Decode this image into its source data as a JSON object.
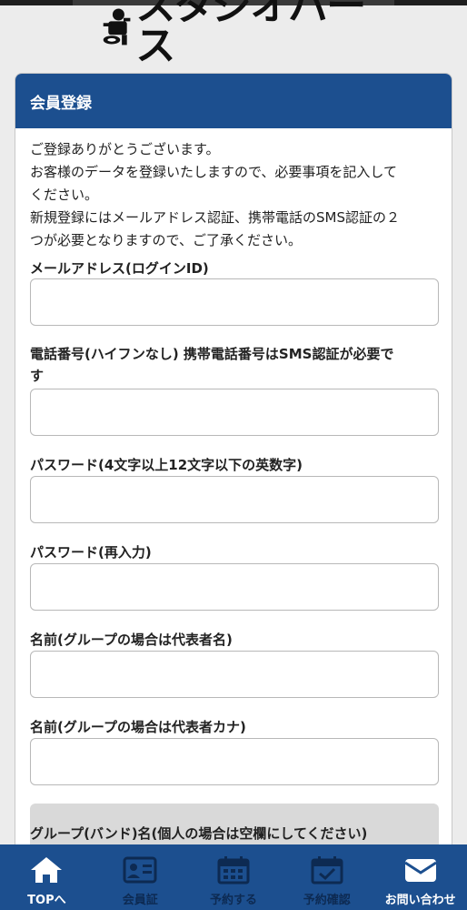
{
  "brand": {
    "logo_text": "スタジオパース"
  },
  "form": {
    "title": "会員登録",
    "intro_lines": [
      "ご登録ありがとうございます。",
      "お客様のデータを登録いたしますので、必要事項を記入して",
      "ください。",
      "新規登録にはメールアドレス認証、携帯電話のSMS認証の２",
      "つが必要となりますので、ご了承ください。"
    ],
    "fields": [
      {
        "label": "メールアドレス(ログインID)",
        "value": ""
      },
      {
        "label_line1": "電話番号(ハイフンなし) 携帯電話番号はSMS認証が必要で",
        "label_line2": "す",
        "value": ""
      },
      {
        "label": "パスワード(4文字以上12文字以下の英数字)",
        "value": ""
      },
      {
        "label": "パスワード(再入力)",
        "value": ""
      },
      {
        "label": "名前(グループの場合は代表者名)",
        "value": ""
      },
      {
        "label": "名前(グループの場合は代表者カナ)",
        "value": ""
      },
      {
        "label": "グループ(バンド)名(個人の場合は空欄にしてください)",
        "value": ""
      }
    ]
  },
  "nav": {
    "items": [
      {
        "label": "TOPへ",
        "icon": "home-icon"
      },
      {
        "label": "会員証",
        "icon": "member-card-icon"
      },
      {
        "label": "予約する",
        "icon": "calendar-icon"
      },
      {
        "label": "予約確認",
        "icon": "calendar-check-icon"
      },
      {
        "label": "お問い合わせ",
        "icon": "mail-icon"
      }
    ]
  },
  "colors": {
    "primary": "#1c4f8f",
    "nav_dim_text": "#0d2a52",
    "page_bg": "#ececec"
  }
}
